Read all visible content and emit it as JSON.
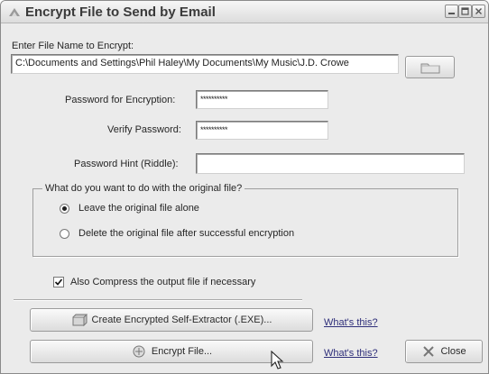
{
  "window": {
    "title": "Encrypt File to Send by Email"
  },
  "file": {
    "label": "Enter File Name to Encrypt:",
    "path": "C:\\Documents and Settings\\Phil Haley\\My Documents\\My Music\\J.D. Crowe",
    "browse_icon": "folder-icon"
  },
  "password": {
    "label": "Password for Encryption:",
    "value": "**********"
  },
  "verify": {
    "label": "Verify Password:",
    "value": "**********"
  },
  "hint": {
    "label": "Password Hint (Riddle):",
    "value": ""
  },
  "original_file": {
    "legend": "What do you want to do with the original file?",
    "options": [
      {
        "label": "Leave the original file alone",
        "selected": true
      },
      {
        "label": "Delete the original file after successful encryption",
        "selected": false
      }
    ]
  },
  "compress": {
    "label": "Also Compress the output file if necessary",
    "checked": true
  },
  "buttons": {
    "self_extractor": "Create Encrypted Self-Extractor (.EXE)...",
    "encrypt": "Encrypt File...",
    "close": "Close"
  },
  "links": {
    "whats_this_1": "What's this?",
    "whats_this_2": "What's this?"
  },
  "colors": {
    "window_bg": "#ebebeb",
    "link": "#2f2f7a"
  }
}
